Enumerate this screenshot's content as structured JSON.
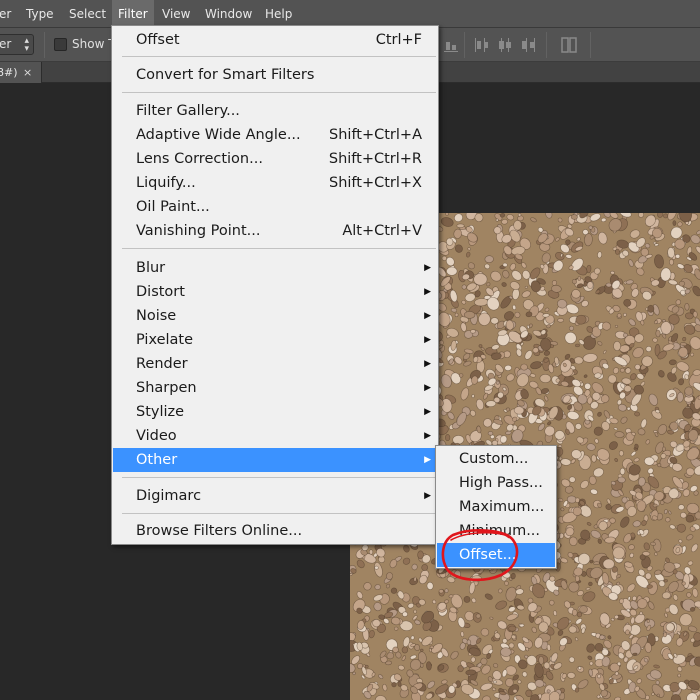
{
  "menubar": {
    "items": [
      {
        "label": "er"
      },
      {
        "label": "Type"
      },
      {
        "label": "Select"
      },
      {
        "label": "Filter"
      },
      {
        "label": "View"
      },
      {
        "label": "Window"
      },
      {
        "label": "Help"
      }
    ],
    "active_index": 3
  },
  "options_bar": {
    "select_value": "er",
    "show_transform_label": "Show Tr"
  },
  "tab": {
    "title": "8#)",
    "close": "×"
  },
  "filter_menu": {
    "items": [
      {
        "label": "Offset",
        "shortcut": "Ctrl+F"
      },
      {
        "label": "Convert for Smart Filters",
        "shortcut": ""
      },
      {
        "label": "Filter Gallery...",
        "shortcut": ""
      },
      {
        "label": "Adaptive Wide Angle...",
        "shortcut": "Shift+Ctrl+A"
      },
      {
        "label": "Lens Correction...",
        "shortcut": "Shift+Ctrl+R"
      },
      {
        "label": "Liquify...",
        "shortcut": "Shift+Ctrl+X"
      },
      {
        "label": "Oil Paint...",
        "shortcut": ""
      },
      {
        "label": "Vanishing Point...",
        "shortcut": "Alt+Ctrl+V"
      },
      {
        "label": "Blur",
        "submenu": true
      },
      {
        "label": "Distort",
        "submenu": true
      },
      {
        "label": "Noise",
        "submenu": true
      },
      {
        "label": "Pixelate",
        "submenu": true
      },
      {
        "label": "Render",
        "submenu": true
      },
      {
        "label": "Sharpen",
        "submenu": true
      },
      {
        "label": "Stylize",
        "submenu": true
      },
      {
        "label": "Video",
        "submenu": true
      },
      {
        "label": "Other",
        "submenu": true,
        "highlighted": true
      },
      {
        "label": "Digimarc",
        "submenu": true
      },
      {
        "label": "Browse Filters Online...",
        "shortcut": ""
      }
    ]
  },
  "other_submenu": {
    "items": [
      {
        "label": "Custom..."
      },
      {
        "label": "High Pass..."
      },
      {
        "label": "Maximum..."
      },
      {
        "label": "Minimum..."
      },
      {
        "label": "Offset...",
        "highlighted": true
      }
    ]
  },
  "submenu_arrow": "▶",
  "colors": {
    "highlight": "#3b92ff",
    "annotation": "#e0161c",
    "menu_bg": "#f0f0f0",
    "app_bg": "#282828",
    "chrome": "#535353"
  }
}
